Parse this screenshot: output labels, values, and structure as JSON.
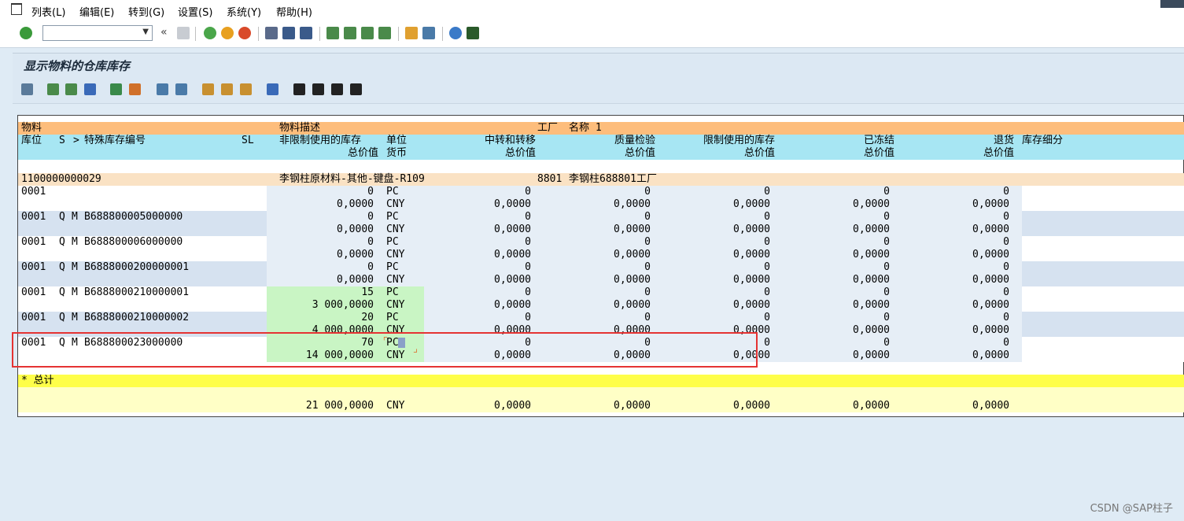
{
  "menu": [
    "列表(L)",
    "编辑(E)",
    "转到(G)",
    "设置(S)",
    "系统(Y)",
    "帮助(H)"
  ],
  "toolbar": {
    "command_value": "",
    "collapse_glyph": "«"
  },
  "title": "显示物料的仓库库存",
  "header": {
    "row1": {
      "material": "物料",
      "desc": "物料描述",
      "plant": "工厂",
      "name": "名称 1"
    },
    "row2": {
      "sloc": "库位",
      "s": "S",
      "gt": ">",
      "special": "特殊库存编号",
      "sl": "SL",
      "unrestricted": "非限制使用的库存",
      "unit": "单位",
      "transfer": "中转和转移",
      "qi": "质量检验",
      "restricted": "限制使用的库存",
      "blocked": "已冻结",
      "returns": "退货",
      "breakdown": "库存细分"
    },
    "row3": {
      "unrestricted": "总价值",
      "unit": "货币",
      "transfer": "总价值",
      "qi": "总价值",
      "restricted": "总价值",
      "blocked": "总价值",
      "returns": "总价值"
    }
  },
  "material_row": {
    "material": "1100000000029",
    "desc": "李钢柱原材料-其他-键盘-R109",
    "plant": "8801",
    "plant_name": "李钢柱688801工厂"
  },
  "rows": [
    {
      "sloc": "0001",
      "s": "",
      "m": "",
      "special": "",
      "qty": "0",
      "unit": "PC",
      "tr": "0",
      "qi": "0",
      "rs": "0",
      "bl": "0",
      "rt": "0",
      "val": "0,0000",
      "cur": "CNY",
      "trv": "0,0000",
      "qiv": "0,0000",
      "rsv": "0,0000",
      "blv": "0,0000",
      "rtv": "0,0000"
    },
    {
      "sloc": "0001",
      "s": "Q",
      "m": "M",
      "special": "B688800005000000",
      "qty": "0",
      "unit": "PC",
      "tr": "0",
      "qi": "0",
      "rs": "0",
      "bl": "0",
      "rt": "0",
      "val": "0,0000",
      "cur": "CNY",
      "trv": "0,0000",
      "qiv": "0,0000",
      "rsv": "0,0000",
      "blv": "0,0000",
      "rtv": "0,0000"
    },
    {
      "sloc": "0001",
      "s": "Q",
      "m": "M",
      "special": "B688800006000000",
      "qty": "0",
      "unit": "PC",
      "tr": "0",
      "qi": "0",
      "rs": "0",
      "bl": "0",
      "rt": "0",
      "val": "0,0000",
      "cur": "CNY",
      "trv": "0,0000",
      "qiv": "0,0000",
      "rsv": "0,0000",
      "blv": "0,0000",
      "rtv": "0,0000"
    },
    {
      "sloc": "0001",
      "s": "Q",
      "m": "M",
      "special": "B6888000200000001",
      "qty": "0",
      "unit": "PC",
      "tr": "0",
      "qi": "0",
      "rs": "0",
      "bl": "0",
      "rt": "0",
      "val": "0,0000",
      "cur": "CNY",
      "trv": "0,0000",
      "qiv": "0,0000",
      "rsv": "0,0000",
      "blv": "0,0000",
      "rtv": "0,0000"
    },
    {
      "sloc": "0001",
      "s": "Q",
      "m": "M",
      "special": "B6888000210000001",
      "qty": "15",
      "unit": "PC",
      "tr": "0",
      "qi": "0",
      "rs": "0",
      "bl": "0",
      "rt": "0",
      "val": "3 000,0000",
      "cur": "CNY",
      "trv": "0,0000",
      "qiv": "0,0000",
      "rsv": "0,0000",
      "blv": "0,0000",
      "rtv": "0,0000"
    },
    {
      "sloc": "0001",
      "s": "Q",
      "m": "M",
      "special": "B6888000210000002",
      "qty": "20",
      "unit": "PC",
      "tr": "0",
      "qi": "0",
      "rs": "0",
      "bl": "0",
      "rt": "0",
      "val": "4 000,0000",
      "cur": "CNY",
      "trv": "0,0000",
      "qiv": "0,0000",
      "rsv": "0,0000",
      "blv": "0,0000",
      "rtv": "0,0000"
    },
    {
      "sloc": "0001",
      "s": "Q",
      "m": "M",
      "special": "B688800023000000",
      "qty": "70",
      "unit": "PC",
      "tr": "0",
      "qi": "0",
      "rs": "0",
      "bl": "0",
      "rt": "0",
      "val": "14 000,0000",
      "cur": "CNY",
      "trv": "0,0000",
      "qiv": "0,0000",
      "rsv": "0,0000",
      "blv": "0,0000",
      "rtv": "0,0000"
    }
  ],
  "total": {
    "label": "* 总计",
    "val": "21 000,0000",
    "cur": "CNY",
    "trv": "0,0000",
    "qiv": "0,0000",
    "rsv": "0,0000",
    "blv": "0,0000",
    "rtv": "0,0000"
  },
  "watermark": "CSDN @SAP柱子",
  "colors": {
    "header_orange": "#fdbd7c",
    "header_cyan": "#a7e6f3",
    "material_row": "#fae2c4",
    "row_alt": "#d6e2f0",
    "value_bg": "#e6eef6",
    "green": "#c9f5c4",
    "total_yellow": "#fefe49",
    "total_light": "#ffffc6"
  }
}
